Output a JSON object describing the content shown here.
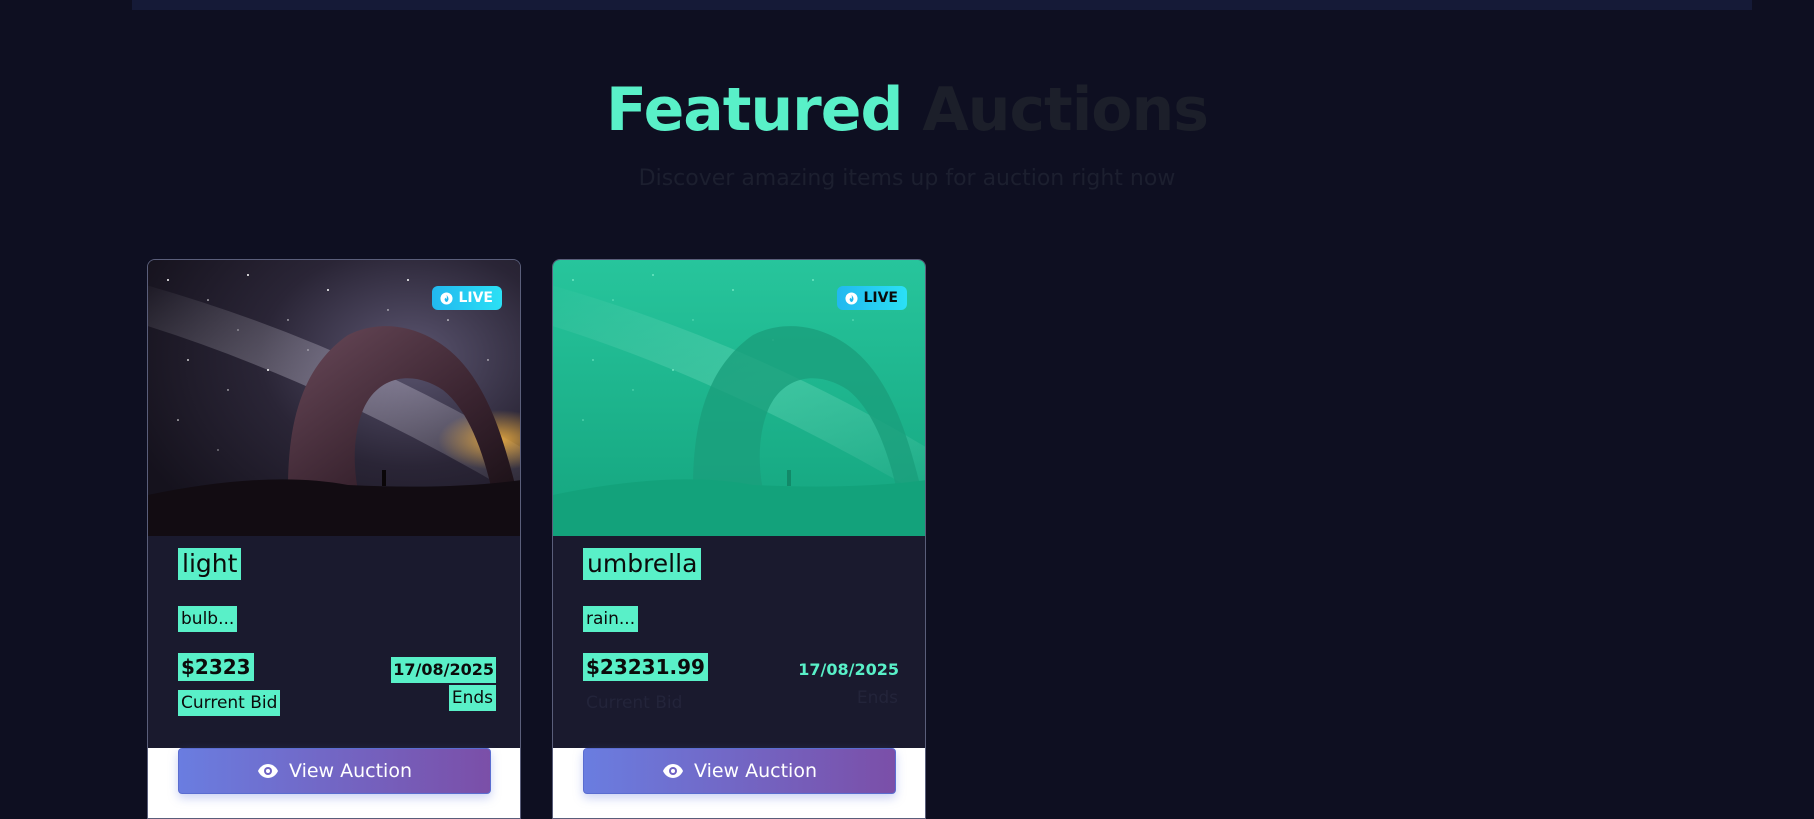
{
  "heading": {
    "word1": "Featured",
    "word2": "Auctions",
    "subtitle": "Discover amazing items up for auction right now"
  },
  "colors": {
    "accent": "#59f0c8",
    "background": "#0e0f21",
    "card": "#1a1a2e",
    "button_start": "#6a7de0",
    "button_end": "#7b4fa8",
    "live_badge": "#22b8ef"
  },
  "cards": [
    {
      "badge": "LIVE",
      "badge_icon": "flame-icon",
      "title": "light",
      "description": "bulb...",
      "price": "$2323",
      "price_label": "Current Bid",
      "end_date": "17/08/2025",
      "end_label": "Ends",
      "button_label": "View Auction",
      "button_icon": "eye-icon"
    },
    {
      "badge": "LIVE",
      "badge_icon": "flame-icon",
      "title": "umbrella",
      "description": "rain...",
      "price": "$23231.99",
      "price_label": "Current Bid",
      "end_date": "17/08/2025",
      "end_label": "Ends",
      "button_label": "View Auction",
      "button_icon": "eye-icon"
    }
  ]
}
